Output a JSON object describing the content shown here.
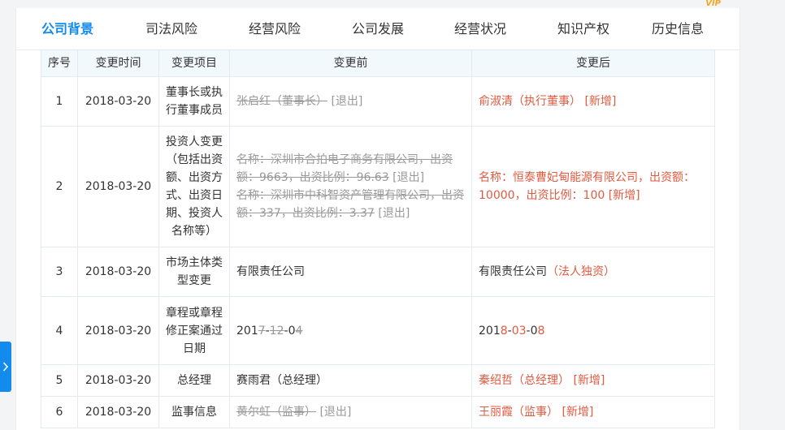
{
  "tabs": [
    {
      "label": "公司背景",
      "active": true
    },
    {
      "label": "司法风险",
      "active": false
    },
    {
      "label": "经营风险",
      "active": false
    },
    {
      "label": "公司发展",
      "active": false
    },
    {
      "label": "经营状况",
      "active": false
    },
    {
      "label": "知识产权",
      "active": false
    },
    {
      "label": "历史信息",
      "active": false,
      "badge": "VIP"
    }
  ],
  "columns": [
    "序号",
    "变更时间",
    "变更项目",
    "变更前",
    "变更后"
  ],
  "rows": [
    {
      "no": "1",
      "date": "2018-03-20",
      "item": "董事长或执行董事成员",
      "before": [
        {
          "segments": [
            {
              "text": "张启红（董事长）",
              "style": "del"
            },
            {
              "text": " [退出]",
              "style": "tag-out"
            }
          ]
        }
      ],
      "after": [
        {
          "segments": [
            {
              "text": "俞淑清（执行董事）",
              "style": "add"
            },
            {
              "text": " [新增]",
              "style": "tag-new"
            }
          ]
        }
      ]
    },
    {
      "no": "2",
      "date": "2018-03-20",
      "item": "投资人变更（包括出资额、出资方式、出资日期、投资人名称等）",
      "before": [
        {
          "segments": [
            {
              "text": "名称：深圳市合拍电子商务有限公司，出资额：9663，出资比例：96.63",
              "style": "del"
            },
            {
              "text": " [退出]",
              "style": "tag-out"
            }
          ]
        },
        {
          "segments": [
            {
              "text": "名称：深圳市中科智资产管理有限公司，出资额：337，出资比例：3.37",
              "style": "del"
            },
            {
              "text": " [退出]",
              "style": "tag-out"
            }
          ]
        }
      ],
      "after": [
        {
          "segments": [
            {
              "text": "名称：恒泰曹妃甸能源有限公司，出资额：10000，出资比例：100",
              "style": "add"
            },
            {
              "text": " [新增]",
              "style": "tag-new"
            }
          ]
        }
      ]
    },
    {
      "no": "3",
      "date": "2018-03-20",
      "item": "市场主体类型变更",
      "before": [
        {
          "segments": [
            {
              "text": "有限责任公司",
              "style": "plain"
            }
          ]
        }
      ],
      "after": [
        {
          "segments": [
            {
              "text": "有限责任公司",
              "style": "plain"
            },
            {
              "text": "（法人独资）",
              "style": "add"
            }
          ]
        }
      ]
    },
    {
      "no": "4",
      "date": "2018-03-20",
      "item": "章程或章程修正案通过日期",
      "before": [
        {
          "segments": [
            {
              "text": "201",
              "style": "plain"
            },
            {
              "text": "7",
              "style": "del"
            },
            {
              "text": "-",
              "style": "plain"
            },
            {
              "text": "12",
              "style": "del"
            },
            {
              "text": "-0",
              "style": "plain"
            },
            {
              "text": "4",
              "style": "del"
            }
          ]
        }
      ],
      "after": [
        {
          "segments": [
            {
              "text": "201",
              "style": "plain"
            },
            {
              "text": "8",
              "style": "add"
            },
            {
              "text": "-",
              "style": "plain"
            },
            {
              "text": "03",
              "style": "add"
            },
            {
              "text": "-0",
              "style": "plain"
            },
            {
              "text": "8",
              "style": "add"
            }
          ]
        }
      ]
    },
    {
      "no": "5",
      "date": "2018-03-20",
      "item": "总经理",
      "before": [
        {
          "segments": [
            {
              "text": "赛雨君（总经理）",
              "style": "plain"
            }
          ]
        }
      ],
      "after": [
        {
          "segments": [
            {
              "text": "秦绍哲（总经理）",
              "style": "add"
            },
            {
              "text": " [新增]",
              "style": "tag-new"
            }
          ]
        }
      ]
    },
    {
      "no": "6",
      "date": "2018-03-20",
      "item": "监事信息",
      "before": [
        {
          "segments": [
            {
              "text": "黄尔虹（监事）",
              "style": "del"
            },
            {
              "text": " [退出]",
              "style": "tag-out"
            }
          ]
        }
      ],
      "after": [
        {
          "segments": [
            {
              "text": "王丽霞（监事）",
              "style": "add"
            },
            {
              "text": " [新增]",
              "style": "tag-new"
            }
          ]
        }
      ]
    }
  ],
  "side_tab_icon": "chevron-right-icon"
}
